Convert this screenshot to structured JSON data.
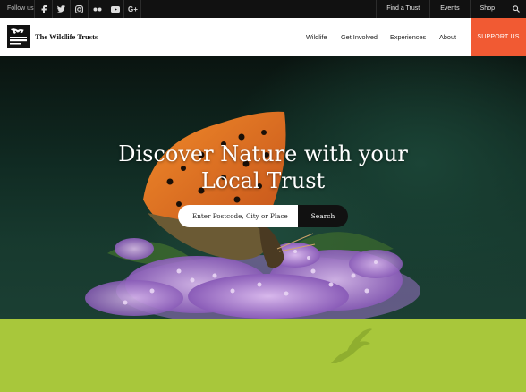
{
  "topbar": {
    "follow_label": "Follow us",
    "social_icons": [
      "facebook-icon",
      "twitter-icon",
      "instagram-icon",
      "flickr-icon",
      "youtube-icon",
      "google-plus-icon"
    ],
    "links": [
      "Find a Trust",
      "Events",
      "Shop"
    ]
  },
  "header": {
    "brand": "The Wildlife Trusts",
    "nav": [
      "Wildlife",
      "Get Involved",
      "Experiences",
      "About"
    ],
    "support_label": "SUPPORT US",
    "accent_color": "#f15a33"
  },
  "hero": {
    "headline_line1": "Discover Nature with your",
    "headline_line2": "Local Trust",
    "search_placeholder": "Enter Postcode, City or Place",
    "search_button": "Search"
  },
  "band": {
    "color": "#a8c73b",
    "icon": "bird-icon"
  }
}
